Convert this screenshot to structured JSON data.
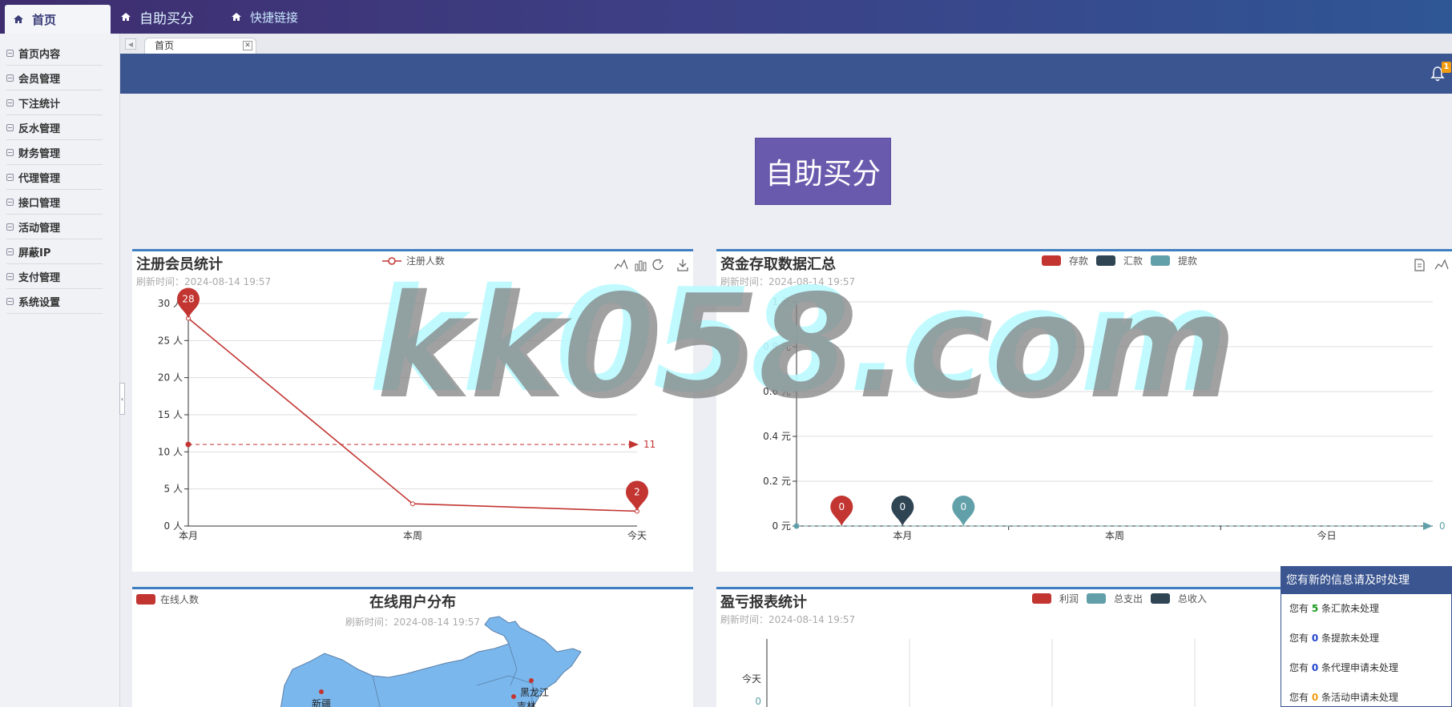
{
  "topnav": {
    "items": [
      {
        "label": "首页",
        "icon": "home-icon"
      },
      {
        "label": "自助买分",
        "icon": "home-icon"
      },
      {
        "label": "快捷链接",
        "icon": "home-icon"
      }
    ]
  },
  "sidebar": {
    "items": [
      {
        "label": "首页内容"
      },
      {
        "label": "会员管理"
      },
      {
        "label": "下注统计"
      },
      {
        "label": "反水管理"
      },
      {
        "label": "财务管理"
      },
      {
        "label": "代理管理"
      },
      {
        "label": "接口管理"
      },
      {
        "label": "活动管理"
      },
      {
        "label": "屏蔽IP"
      },
      {
        "label": "支付管理"
      },
      {
        "label": "系统设置"
      }
    ]
  },
  "tabs": [
    {
      "label": "首页"
    }
  ],
  "header": {
    "notification_count": "1"
  },
  "main": {
    "big_button": "自助买分"
  },
  "panels": {
    "members": {
      "title": "注册会员统计",
      "refresh": "刷新时间：2024-08-14 19:57",
      "legend": "注册人数"
    },
    "funds": {
      "title": "资金存取数据汇总",
      "refresh": "刷新时间：2024-08-14 19:57",
      "legend": [
        "存款",
        "汇款",
        "提款"
      ]
    },
    "online": {
      "title": "在线用户分布",
      "refresh": "刷新时间：2024-08-14 19:57",
      "legend": "在线人数",
      "regions": [
        "黑龙江",
        "新疆",
        "吉林"
      ]
    },
    "profit": {
      "title": "盈亏报表统计",
      "refresh": "刷新时间：2024-08-14 19:57",
      "legend": [
        "利润",
        "总支出",
        "总收入"
      ],
      "row_label": "今天",
      "row_value": "0"
    }
  },
  "notify": {
    "title": "您有新的信息请及时处理",
    "rows": [
      {
        "prefix": "您有",
        "count": "5",
        "suffix": "条汇款未处理"
      },
      {
        "prefix": "您有",
        "count": "0",
        "suffix": "条提款未处理"
      },
      {
        "prefix": "您有",
        "count": "0",
        "suffix": "条代理申请未处理"
      },
      {
        "prefix": "您有",
        "count": "0",
        "suffix": "条活动申请未处理"
      }
    ]
  },
  "watermark": "kk058.com",
  "colors": {
    "accent": "#3a5590",
    "red": "#c23531",
    "dark": "#2f4554",
    "teal": "#61a0a8",
    "purple": "#6a5aad"
  },
  "chart_data": [
    {
      "type": "line",
      "title": "注册会员统计",
      "categories": [
        "本月",
        "本周",
        "今天"
      ],
      "series": [
        {
          "name": "注册人数",
          "values": [
            28,
            3,
            2
          ]
        }
      ],
      "markpoints": [
        {
          "label": "28",
          "category": "本月"
        },
        {
          "label": "2",
          "category": "今天"
        }
      ],
      "markline": {
        "label": "11",
        "value": 11
      },
      "yticks": [
        "0 人",
        "5 人",
        "10 人",
        "15 人",
        "20 人",
        "25 人",
        "30 人"
      ],
      "ylim": [
        0,
        30
      ],
      "grid": true,
      "legend": "top-center"
    },
    {
      "type": "bar",
      "title": "资金存取数据汇总",
      "categories": [
        "本月",
        "本周",
        "今日"
      ],
      "series": [
        {
          "name": "存款",
          "values": [
            0,
            0,
            0
          ]
        },
        {
          "name": "汇款",
          "values": [
            0,
            0,
            0
          ]
        },
        {
          "name": "提款",
          "values": [
            0,
            0,
            0
          ]
        }
      ],
      "markpoints": [
        "0",
        "0",
        "0"
      ],
      "markline": {
        "label": "0",
        "value": 0
      },
      "yticks": [
        "0 元",
        "0.2 元",
        "0.4 元",
        "0.6 元",
        "0.8 元",
        "1 元"
      ],
      "ylim": [
        0,
        1
      ],
      "grid": true,
      "legend": "top-center"
    }
  ]
}
